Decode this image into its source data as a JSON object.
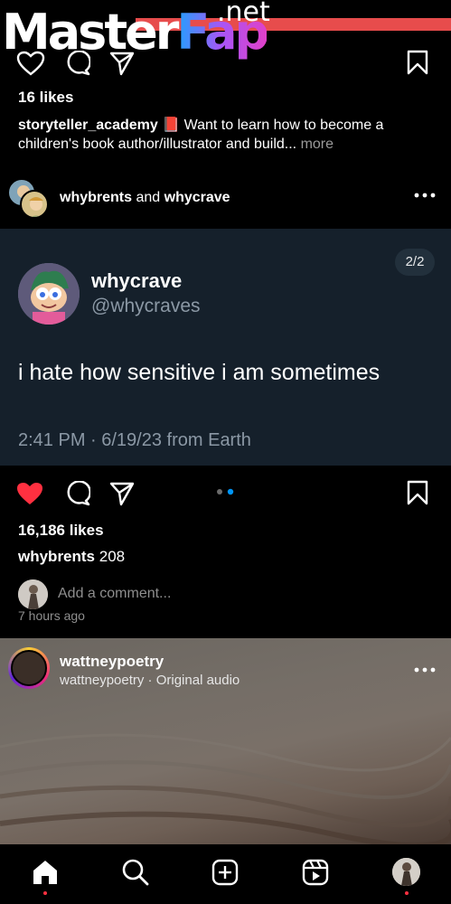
{
  "watermark": {
    "brand_first": "Master",
    "brand_second": "Fap",
    "suffix": ".net"
  },
  "post1": {
    "likes": "16 likes",
    "caption_user": "storyteller_academy",
    "caption_emoji": "📕",
    "caption_text": " Want to learn how to become a children's book author/illustrator and build...",
    "more_label": "more"
  },
  "post2": {
    "collab_user1": "whybrents",
    "collab_and": "and",
    "collab_user2": "whycrave",
    "tweet": {
      "name": "whycrave",
      "handle": "@whycraves",
      "body": "i hate how sensitive i am sometimes",
      "meta": "2:41 PM · 6/19/23 from Earth",
      "page_indicator": "2/2"
    },
    "likes": "16,186 likes",
    "comment_user": "whybrents",
    "comment_text": "208",
    "add_comment_placeholder": "Add a comment...",
    "time_ago": "7 hours ago",
    "liked": true
  },
  "reel": {
    "username": "wattneypoetry",
    "subtitle": "wattneypoetry · Original audio"
  },
  "nav": {
    "items": [
      "home-icon",
      "search-icon",
      "create-icon",
      "reels-icon",
      "profile-avatar"
    ]
  },
  "colors": {
    "like_red": "#ff3040",
    "tweet_bg": "#15202b",
    "muted": "#8e8e8e",
    "tweet_muted": "#8b98a5",
    "carousel_active": "#0095f6"
  }
}
